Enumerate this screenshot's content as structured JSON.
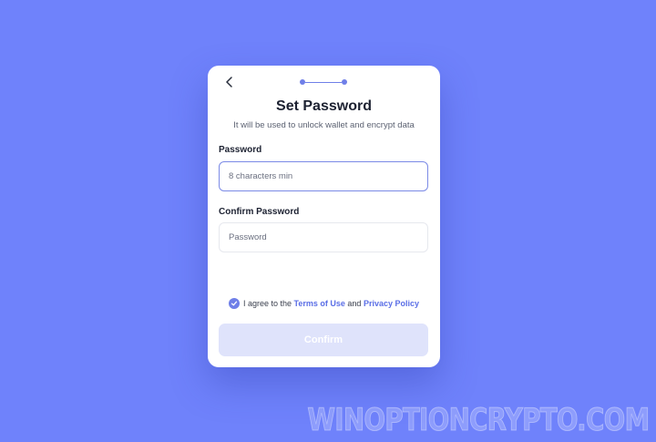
{
  "header": {
    "title": "Set Password",
    "subtitle": "It will be used to unlock wallet and encrypt data",
    "back_icon": "chevron-left-icon",
    "step_current": 1,
    "step_total": 2
  },
  "form": {
    "password_label": "Password",
    "password_value": "",
    "password_placeholder": "8 characters min",
    "confirm_label": "Confirm Password",
    "confirm_value": "",
    "confirm_placeholder": "Password"
  },
  "agreement": {
    "checked": true,
    "prefix": "I agree to the ",
    "terms_link": "Terms of Use",
    "middle": " and ",
    "privacy_link": "Privacy Policy"
  },
  "actions": {
    "confirm_label": "Confirm",
    "confirm_enabled": false
  },
  "watermark": "WINOPTIONCRYPTO.COM",
  "colors": {
    "background": "#6f82fb",
    "accent": "#6f7fe8",
    "link": "#5a6ee6",
    "button_disabled": "#dfe3fb"
  }
}
